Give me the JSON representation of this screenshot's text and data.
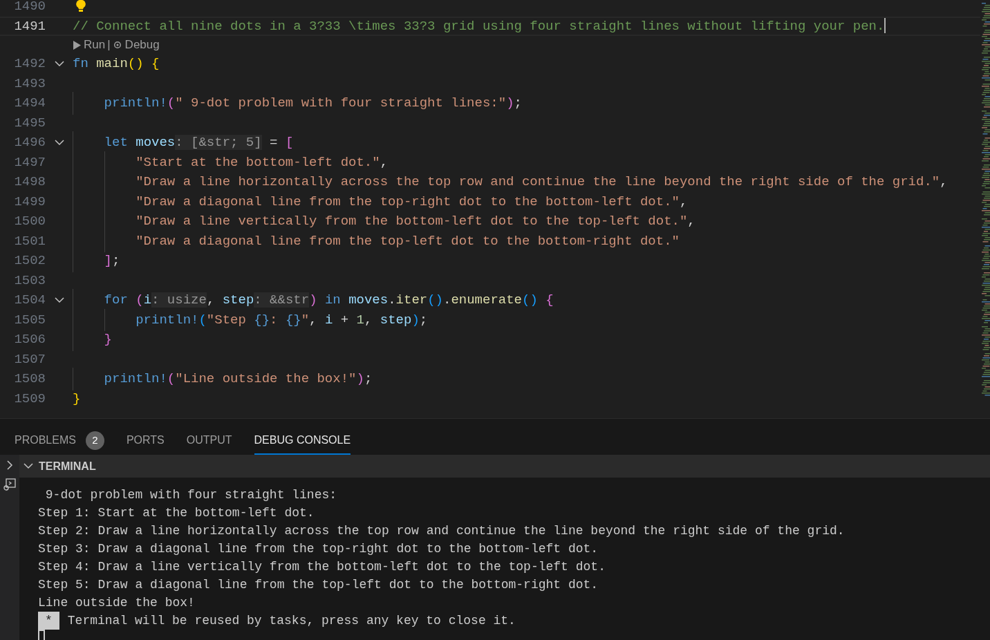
{
  "editor": {
    "lines": [
      {
        "number": "1490",
        "current": false,
        "fold": false,
        "lightbulb": true
      },
      {
        "number": "1491",
        "current": true,
        "fold": false,
        "lightbulb": false,
        "tokens": [
          {
            "text": "// Connect all nine dots in a 3?33 \\times 33?3 grid using four straight lines without lifting your pen.",
            "kind": "comment"
          }
        ]
      },
      {
        "kind": "codelens",
        "run": "Run",
        "separator": "|",
        "debug": "Debug"
      },
      {
        "number": "1492",
        "current": false,
        "fold": true,
        "lightbulb": false,
        "tokens": [
          {
            "text": "fn",
            "kind": "keyword"
          },
          {
            "text": " main",
            "kind": "function"
          },
          {
            "text": "()",
            "kind": "bracket1"
          },
          {
            "text": " {",
            "kind": "bracket1"
          }
        ]
      },
      {
        "number": "1493",
        "current": false,
        "fold": false,
        "lightbulb": false
      },
      {
        "number": "1494",
        "current": false,
        "fold": false,
        "lightbulb": false,
        "tokens": [
          {
            "text": "    println!",
            "kind": "macro"
          },
          {
            "text": "(",
            "kind": "bracket2"
          },
          {
            "text": "\" 9-dot problem with four straight lines:\"",
            "kind": "string"
          },
          {
            "text": ")",
            "kind": "bracket2"
          },
          {
            "text": ";",
            "kind": "plain"
          }
        ]
      },
      {
        "number": "1495",
        "current": false,
        "fold": false,
        "lightbulb": false
      },
      {
        "number": "1496",
        "current": false,
        "fold": true,
        "lightbulb": false,
        "tokens": [
          {
            "text": "    let",
            "kind": "keyword"
          },
          {
            "text": " moves",
            "kind": "variable"
          },
          {
            "text": ": [&str; 5]",
            "kind": "hint"
          },
          {
            "text": " =",
            "kind": "plain"
          },
          {
            "text": " [",
            "kind": "bracket2"
          }
        ]
      },
      {
        "number": "1497",
        "current": false,
        "fold": false,
        "lightbulb": false,
        "tokens": [
          {
            "text": "        \"Start at the bottom-left dot.\"",
            "kind": "string"
          },
          {
            "text": ",",
            "kind": "plain"
          }
        ]
      },
      {
        "number": "1498",
        "current": false,
        "fold": false,
        "lightbulb": false,
        "tokens": [
          {
            "text": "        \"Draw a line horizontally across the top row and continue the line beyond the right side of the grid.\"",
            "kind": "string"
          },
          {
            "text": ",",
            "kind": "plain"
          }
        ]
      },
      {
        "number": "1499",
        "current": false,
        "fold": false,
        "lightbulb": false,
        "tokens": [
          {
            "text": "        \"Draw a diagonal line from the top-right dot to the bottom-left dot.\"",
            "kind": "string"
          },
          {
            "text": ",",
            "kind": "plain"
          }
        ]
      },
      {
        "number": "1500",
        "current": false,
        "fold": false,
        "lightbulb": false,
        "tokens": [
          {
            "text": "        \"Draw a line vertically from the bottom-left dot to the top-left dot.\"",
            "kind": "string"
          },
          {
            "text": ",",
            "kind": "plain"
          }
        ]
      },
      {
        "number": "1501",
        "current": false,
        "fold": false,
        "lightbulb": false,
        "tokens": [
          {
            "text": "        \"Draw a diagonal line from the top-left dot to the bottom-right dot.\"",
            "kind": "string"
          }
        ]
      },
      {
        "number": "1502",
        "current": false,
        "fold": false,
        "lightbulb": false,
        "tokens": [
          {
            "text": "    ]",
            "kind": "bracket2"
          },
          {
            "text": ";",
            "kind": "plain"
          }
        ]
      },
      {
        "number": "1503",
        "current": false,
        "fold": false,
        "lightbulb": false
      },
      {
        "number": "1504",
        "current": false,
        "fold": true,
        "lightbulb": false,
        "tokens": [
          {
            "text": "    for",
            "kind": "keyword"
          },
          {
            "text": " (",
            "kind": "bracket2"
          },
          {
            "text": "i",
            "kind": "variable"
          },
          {
            "text": ": usize",
            "kind": "hint"
          },
          {
            "text": ",",
            "kind": "plain"
          },
          {
            "text": " step",
            "kind": "variable"
          },
          {
            "text": ": &&str",
            "kind": "hint"
          },
          {
            "text": ")",
            "kind": "bracket2"
          },
          {
            "text": " in",
            "kind": "keyword"
          },
          {
            "text": " moves",
            "kind": "variable"
          },
          {
            "text": ".",
            "kind": "plain"
          },
          {
            "text": "iter",
            "kind": "function"
          },
          {
            "text": "()",
            "kind": "bracket3"
          },
          {
            "text": ".",
            "kind": "plain"
          },
          {
            "text": "enumerate",
            "kind": "function"
          },
          {
            "text": "()",
            "kind": "bracket3"
          },
          {
            "text": " {",
            "kind": "bracket2"
          }
        ]
      },
      {
        "number": "1505",
        "current": false,
        "fold": false,
        "lightbulb": false,
        "tokens": [
          {
            "text": "        println!",
            "kind": "macro"
          },
          {
            "text": "(",
            "kind": "bracket3"
          },
          {
            "text": "\"Step ",
            "kind": "string"
          },
          {
            "text": "{}",
            "kind": "placeholder"
          },
          {
            "text": ":",
            "kind": "string"
          },
          {
            "text": " {}",
            "kind": "placeholder"
          },
          {
            "text": "\"",
            "kind": "string"
          },
          {
            "text": ",",
            "kind": "plain"
          },
          {
            "text": " i",
            "kind": "variable"
          },
          {
            "text": " +",
            "kind": "plain"
          },
          {
            "text": " 1",
            "kind": "number"
          },
          {
            "text": ",",
            "kind": "plain"
          },
          {
            "text": " step",
            "kind": "variable"
          },
          {
            "text": ")",
            "kind": "bracket3"
          },
          {
            "text": ";",
            "kind": "plain"
          }
        ]
      },
      {
        "number": "1506",
        "current": false,
        "fold": false,
        "lightbulb": false,
        "tokens": [
          {
            "text": "    }",
            "kind": "bracket2"
          }
        ]
      },
      {
        "number": "1507",
        "current": false,
        "fold": false,
        "lightbulb": false
      },
      {
        "number": "1508",
        "current": false,
        "fold": false,
        "lightbulb": false,
        "tokens": [
          {
            "text": "    println!",
            "kind": "macro"
          },
          {
            "text": "(",
            "kind": "bracket2"
          },
          {
            "text": "\"Line outside the box!\"",
            "kind": "string"
          },
          {
            "text": ")",
            "kind": "bracket2"
          },
          {
            "text": ";",
            "kind": "plain"
          }
        ]
      },
      {
        "number": "1509",
        "current": false,
        "fold": false,
        "lightbulb": false,
        "tokens": [
          {
            "text": "}",
            "kind": "bracket1"
          }
        ]
      }
    ]
  },
  "panel": {
    "tabs": [
      {
        "label": "PROBLEMS",
        "badge": "2",
        "selected": false
      },
      {
        "label": "PORTS",
        "selected": false
      },
      {
        "label": "OUTPUT",
        "selected": false
      },
      {
        "label": "DEBUG CONSOLE",
        "selected": true
      }
    ],
    "terminal": {
      "title": "TERMINAL",
      "expanded": true,
      "lines": [
        " 9-dot problem with four straight lines:",
        "Step 1: Start at the bottom-left dot.",
        "Step 2: Draw a line horizontally across the top row and continue the line beyond the right side of the grid.",
        "Step 3: Draw a diagonal line from the top-right dot to the bottom-left dot.",
        "Step 4: Draw a line vertically from the bottom-left dot to the top-left dot.",
        "Step 5: Draw a diagonal line from the top-left dot to the bottom-right dot.",
        "Line outside the box!"
      ],
      "task_marker": "*",
      "task_message": "Terminal will be reused by tasks, press any key to close it."
    }
  }
}
